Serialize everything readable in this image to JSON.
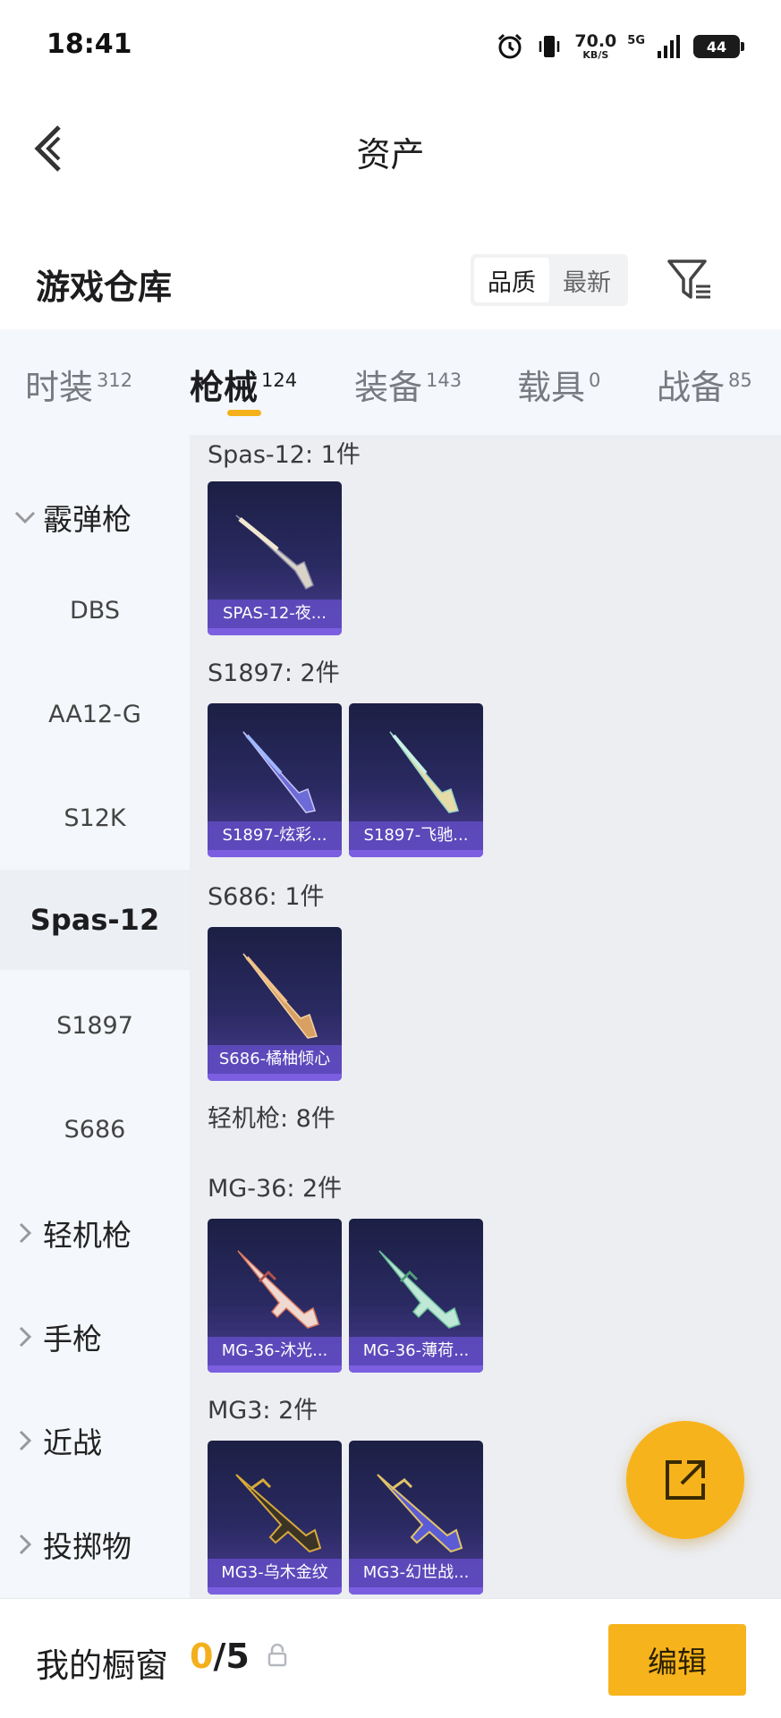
{
  "status_bar": {
    "time": "18:41",
    "net_speed": "70.0",
    "net_speed_unit": "KB/S",
    "network": "5G",
    "battery": "44"
  },
  "header": {
    "title": "资产"
  },
  "warehouse": {
    "title": "游戏仓库",
    "sort_options": [
      "品质",
      "最新"
    ],
    "sort_active": "品质"
  },
  "tabs": [
    {
      "label": "时装",
      "count": "312"
    },
    {
      "label": "枪械",
      "count": "124"
    },
    {
      "label": "装备",
      "count": "143"
    },
    {
      "label": "载具",
      "count": "0"
    },
    {
      "label": "战备",
      "count": "85"
    }
  ],
  "active_tab": "枪械",
  "sidebar": {
    "category_shotgun": "霰弹枪",
    "sub_items": [
      "DBS",
      "AA12-G",
      "S12K",
      "Spas-12",
      "S1897",
      "S686"
    ],
    "selected_item": "Spas-12",
    "categories_collapsed": [
      "轻机枪",
      "手枪",
      "近战",
      "投掷物"
    ]
  },
  "content": {
    "groups": [
      {
        "label": "Spas-12: 1件",
        "items": [
          "SPAS-12-夜..."
        ]
      },
      {
        "label": "S1897: 2件",
        "items": [
          "S1897-炫彩...",
          "S1897-飞驰..."
        ]
      },
      {
        "label": "S686: 1件",
        "items": [
          "S686-橘柚倾心"
        ]
      },
      {
        "label": "轻机枪: 8件",
        "items": []
      },
      {
        "label": "MG-36: 2件",
        "items": [
          "MG-36-沐光...",
          "MG-36-薄荷..."
        ]
      },
      {
        "label": "MG3: 2件",
        "items": [
          "MG3-乌木金纹",
          "MG3-幻世战..."
        ]
      }
    ]
  },
  "bottom_bar": {
    "showcase_label": "我的橱窗",
    "showcase_current": "0",
    "showcase_total": "/5",
    "edit_label": "编辑"
  },
  "colors": {
    "accent": "#f7b31c",
    "card_bg": "#2a2a62",
    "card_label": "#624cc4"
  }
}
